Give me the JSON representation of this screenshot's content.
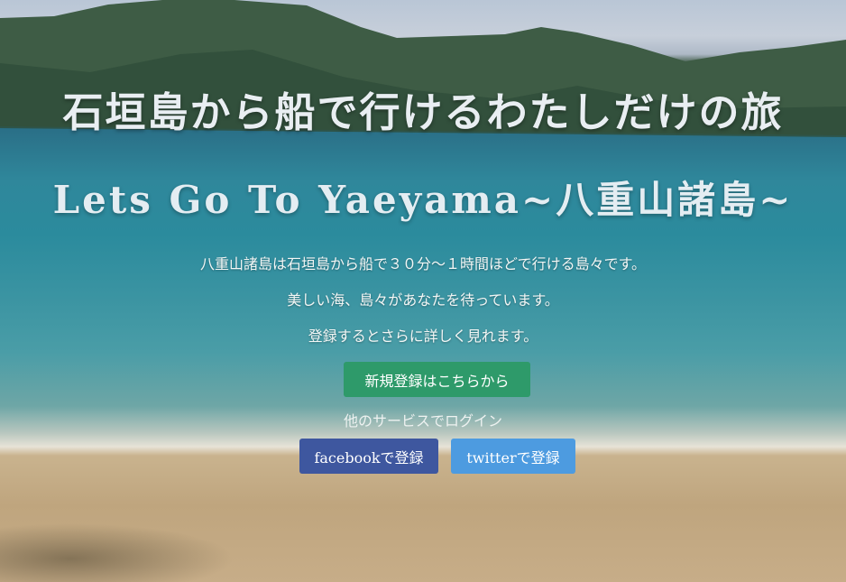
{
  "hero": {
    "title": "石垣島から船で行けるわたしだけの旅",
    "subtitle": "Lets Go To Yaeyama~八重山諸島~",
    "description_lines": [
      "八重山諸島は石垣島から船で３０分〜１時間ほどで行ける島々です。",
      "美しい海、島々があなたを待っています。",
      "登録するとさらに詳しく見れます。"
    ]
  },
  "actions": {
    "signup_label": "新規登録はこちらから",
    "other_login_text": "他のサービスでログイン",
    "facebook_label": "facebookで登録",
    "twitter_label": "twitterで登録"
  },
  "colors": {
    "signup_button": "#2e9a6a",
    "facebook_button": "#3e579f",
    "twitter_button": "#4d9be0"
  }
}
